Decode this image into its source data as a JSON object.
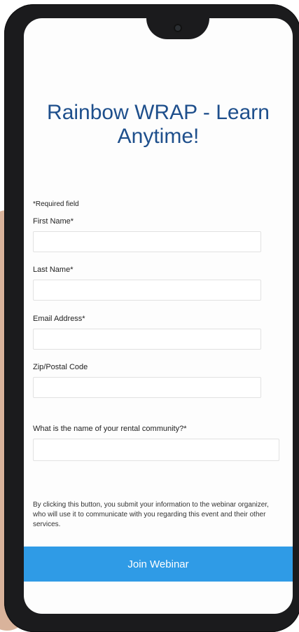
{
  "page": {
    "title": "Rainbow WRAP - Learn Anytime!",
    "required_note": "*Required field"
  },
  "form": {
    "fields": [
      {
        "label": "First Name*",
        "value": ""
      },
      {
        "label": "Last Name*",
        "value": ""
      },
      {
        "label": "Email Address*",
        "value": ""
      },
      {
        "label": "Zip/Postal Code",
        "value": ""
      },
      {
        "label": "What is the name of your rental community?*",
        "value": ""
      }
    ]
  },
  "notice": "By clicking this button, you submit your information to the webinar organizer, who will use it to communicate with you regarding this event and their other services.",
  "button": {
    "label": "Join Webinar"
  },
  "colors": {
    "title": "#1e4f8c",
    "button": "#2f9be6"
  }
}
